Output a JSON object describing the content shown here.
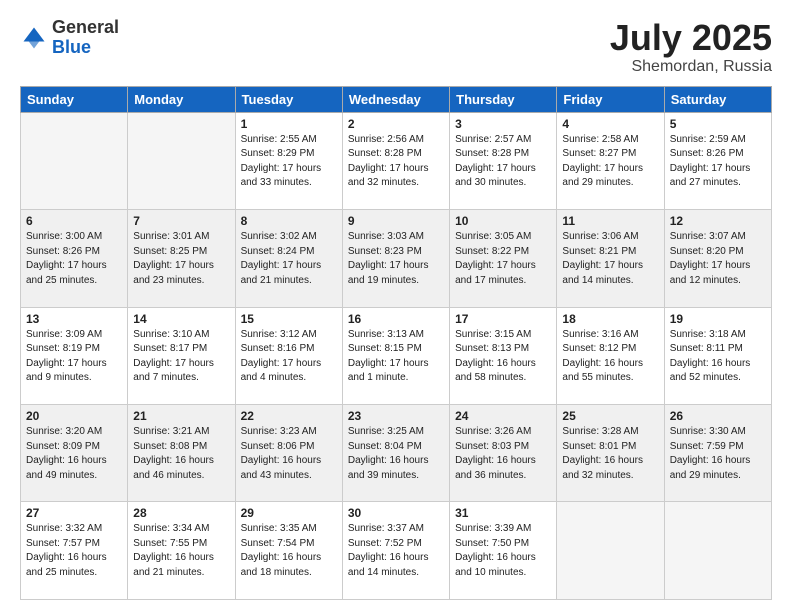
{
  "logo": {
    "general": "General",
    "blue": "Blue"
  },
  "title": {
    "month_year": "July 2025",
    "location": "Shemordan, Russia"
  },
  "days_of_week": [
    "Sunday",
    "Monday",
    "Tuesday",
    "Wednesday",
    "Thursday",
    "Friday",
    "Saturday"
  ],
  "weeks": [
    [
      {
        "num": "",
        "info": ""
      },
      {
        "num": "",
        "info": ""
      },
      {
        "num": "1",
        "info": "Sunrise: 2:55 AM\nSunset: 8:29 PM\nDaylight: 17 hours\nand 33 minutes."
      },
      {
        "num": "2",
        "info": "Sunrise: 2:56 AM\nSunset: 8:28 PM\nDaylight: 17 hours\nand 32 minutes."
      },
      {
        "num": "3",
        "info": "Sunrise: 2:57 AM\nSunset: 8:28 PM\nDaylight: 17 hours\nand 30 minutes."
      },
      {
        "num": "4",
        "info": "Sunrise: 2:58 AM\nSunset: 8:27 PM\nDaylight: 17 hours\nand 29 minutes."
      },
      {
        "num": "5",
        "info": "Sunrise: 2:59 AM\nSunset: 8:26 PM\nDaylight: 17 hours\nand 27 minutes."
      }
    ],
    [
      {
        "num": "6",
        "info": "Sunrise: 3:00 AM\nSunset: 8:26 PM\nDaylight: 17 hours\nand 25 minutes."
      },
      {
        "num": "7",
        "info": "Sunrise: 3:01 AM\nSunset: 8:25 PM\nDaylight: 17 hours\nand 23 minutes."
      },
      {
        "num": "8",
        "info": "Sunrise: 3:02 AM\nSunset: 8:24 PM\nDaylight: 17 hours\nand 21 minutes."
      },
      {
        "num": "9",
        "info": "Sunrise: 3:03 AM\nSunset: 8:23 PM\nDaylight: 17 hours\nand 19 minutes."
      },
      {
        "num": "10",
        "info": "Sunrise: 3:05 AM\nSunset: 8:22 PM\nDaylight: 17 hours\nand 17 minutes."
      },
      {
        "num": "11",
        "info": "Sunrise: 3:06 AM\nSunset: 8:21 PM\nDaylight: 17 hours\nand 14 minutes."
      },
      {
        "num": "12",
        "info": "Sunrise: 3:07 AM\nSunset: 8:20 PM\nDaylight: 17 hours\nand 12 minutes."
      }
    ],
    [
      {
        "num": "13",
        "info": "Sunrise: 3:09 AM\nSunset: 8:19 PM\nDaylight: 17 hours\nand 9 minutes."
      },
      {
        "num": "14",
        "info": "Sunrise: 3:10 AM\nSunset: 8:17 PM\nDaylight: 17 hours\nand 7 minutes."
      },
      {
        "num": "15",
        "info": "Sunrise: 3:12 AM\nSunset: 8:16 PM\nDaylight: 17 hours\nand 4 minutes."
      },
      {
        "num": "16",
        "info": "Sunrise: 3:13 AM\nSunset: 8:15 PM\nDaylight: 17 hours\nand 1 minute."
      },
      {
        "num": "17",
        "info": "Sunrise: 3:15 AM\nSunset: 8:13 PM\nDaylight: 16 hours\nand 58 minutes."
      },
      {
        "num": "18",
        "info": "Sunrise: 3:16 AM\nSunset: 8:12 PM\nDaylight: 16 hours\nand 55 minutes."
      },
      {
        "num": "19",
        "info": "Sunrise: 3:18 AM\nSunset: 8:11 PM\nDaylight: 16 hours\nand 52 minutes."
      }
    ],
    [
      {
        "num": "20",
        "info": "Sunrise: 3:20 AM\nSunset: 8:09 PM\nDaylight: 16 hours\nand 49 minutes."
      },
      {
        "num": "21",
        "info": "Sunrise: 3:21 AM\nSunset: 8:08 PM\nDaylight: 16 hours\nand 46 minutes."
      },
      {
        "num": "22",
        "info": "Sunrise: 3:23 AM\nSunset: 8:06 PM\nDaylight: 16 hours\nand 43 minutes."
      },
      {
        "num": "23",
        "info": "Sunrise: 3:25 AM\nSunset: 8:04 PM\nDaylight: 16 hours\nand 39 minutes."
      },
      {
        "num": "24",
        "info": "Sunrise: 3:26 AM\nSunset: 8:03 PM\nDaylight: 16 hours\nand 36 minutes."
      },
      {
        "num": "25",
        "info": "Sunrise: 3:28 AM\nSunset: 8:01 PM\nDaylight: 16 hours\nand 32 minutes."
      },
      {
        "num": "26",
        "info": "Sunrise: 3:30 AM\nSunset: 7:59 PM\nDaylight: 16 hours\nand 29 minutes."
      }
    ],
    [
      {
        "num": "27",
        "info": "Sunrise: 3:32 AM\nSunset: 7:57 PM\nDaylight: 16 hours\nand 25 minutes."
      },
      {
        "num": "28",
        "info": "Sunrise: 3:34 AM\nSunset: 7:55 PM\nDaylight: 16 hours\nand 21 minutes."
      },
      {
        "num": "29",
        "info": "Sunrise: 3:35 AM\nSunset: 7:54 PM\nDaylight: 16 hours\nand 18 minutes."
      },
      {
        "num": "30",
        "info": "Sunrise: 3:37 AM\nSunset: 7:52 PM\nDaylight: 16 hours\nand 14 minutes."
      },
      {
        "num": "31",
        "info": "Sunrise: 3:39 AM\nSunset: 7:50 PM\nDaylight: 16 hours\nand 10 minutes."
      },
      {
        "num": "",
        "info": ""
      },
      {
        "num": "",
        "info": ""
      }
    ]
  ]
}
